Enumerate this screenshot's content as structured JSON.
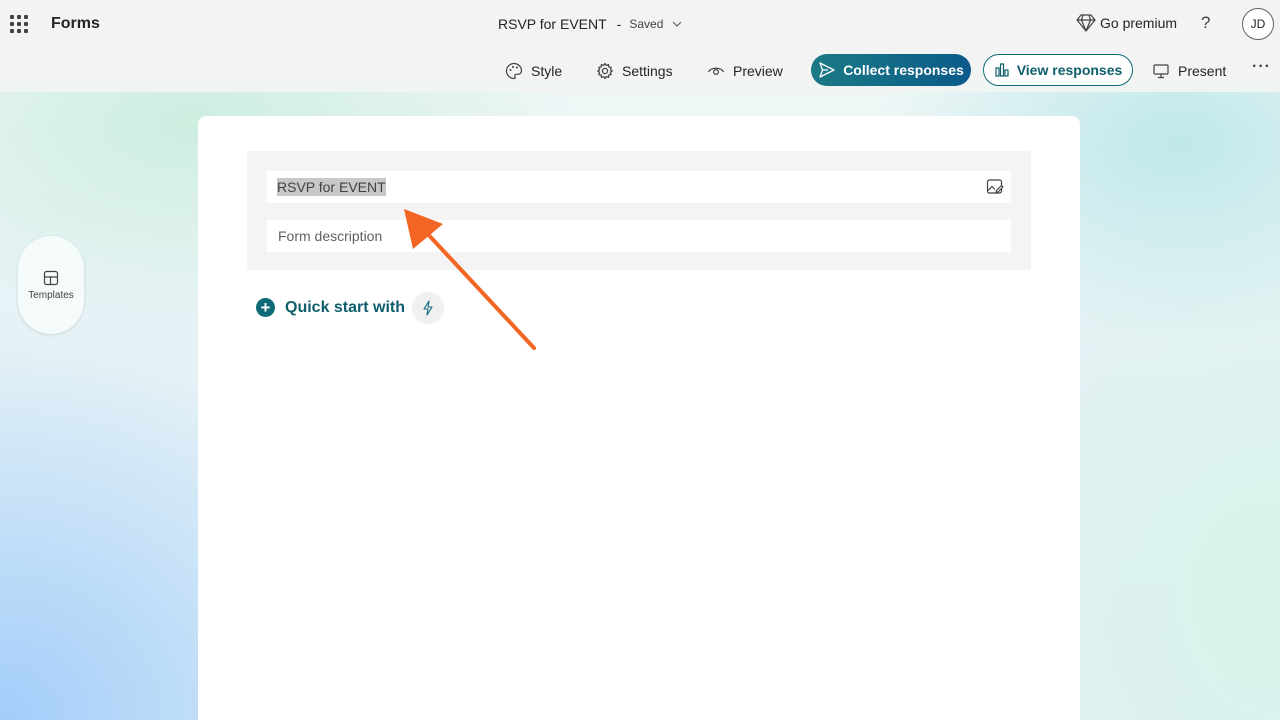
{
  "app": {
    "name": "Forms",
    "document_title": "RSVP for EVENT",
    "separator": "-",
    "save_status": "Saved"
  },
  "account": {
    "premium_label": "Go premium",
    "help_label": "?",
    "avatar_initials": "JD"
  },
  "commands": {
    "style": "Style",
    "settings": "Settings",
    "preview": "Preview",
    "collect": "Collect responses",
    "view_responses": "View responses",
    "present": "Present",
    "more": "···"
  },
  "sidebar": {
    "templates_label": "Templates"
  },
  "form": {
    "title_value": "RSVP for EVENT",
    "description_placeholder": "Form description",
    "quick_start_label": "Quick start with",
    "quick_start_plus": "+"
  },
  "annotation": {
    "arrow_color": "#f26522",
    "accent_color": "#0e6b76"
  }
}
